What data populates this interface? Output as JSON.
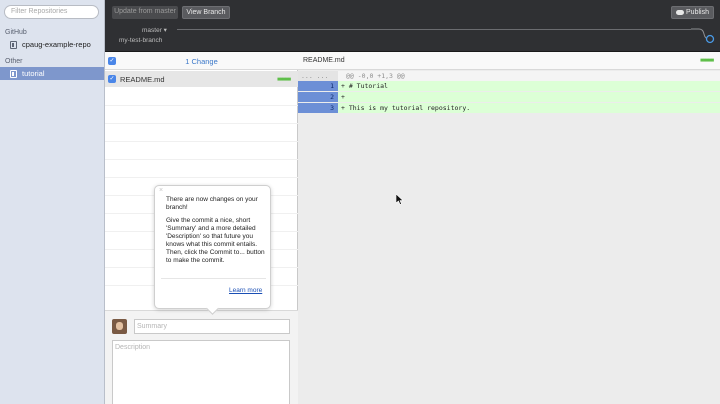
{
  "sidebar": {
    "filter_placeholder": "Filter Repositories",
    "sections": [
      {
        "label": "GitHub",
        "repos": [
          {
            "name": "cpaug-example-repo",
            "selected": false
          }
        ]
      },
      {
        "label": "Other",
        "repos": [
          {
            "name": "tutorial",
            "selected": true
          }
        ]
      }
    ]
  },
  "toolbar": {
    "update_label": "Update from master",
    "view_branch_label": "View Branch",
    "publish_label": "Publish",
    "base_branch": "master ▾",
    "current_branch": "my-test-branch"
  },
  "changes": {
    "count_label": "1 Change",
    "files": [
      {
        "name": "README.md",
        "checked": true
      }
    ],
    "summary_placeholder": "Summary",
    "description_placeholder": "Description"
  },
  "diff": {
    "file_name": "README.md",
    "hunk_gutter": "... ...",
    "hunk_header": "@@ -0,0 +1,3 @@",
    "lines": [
      {
        "num": "1",
        "text": "+ # Tutorial"
      },
      {
        "num": "2",
        "text": "+"
      },
      {
        "num": "3",
        "text": "+ This is my tutorial repository."
      }
    ]
  },
  "popover": {
    "close_glyph": "×",
    "title": "There are now changes on your branch!",
    "body": "Give the commit a nice, short 'Summary' and a more detailed 'Description' so that future you knows what this commit entails. Then, click the Commit to... button to make the commit.",
    "link": "Learn more"
  },
  "colors": {
    "selected_repo": "#7e97cc",
    "accent_blue": "#3b78c9",
    "diff_added_bg": "#dcffd6",
    "line_gutter": "#6c8fd6"
  }
}
